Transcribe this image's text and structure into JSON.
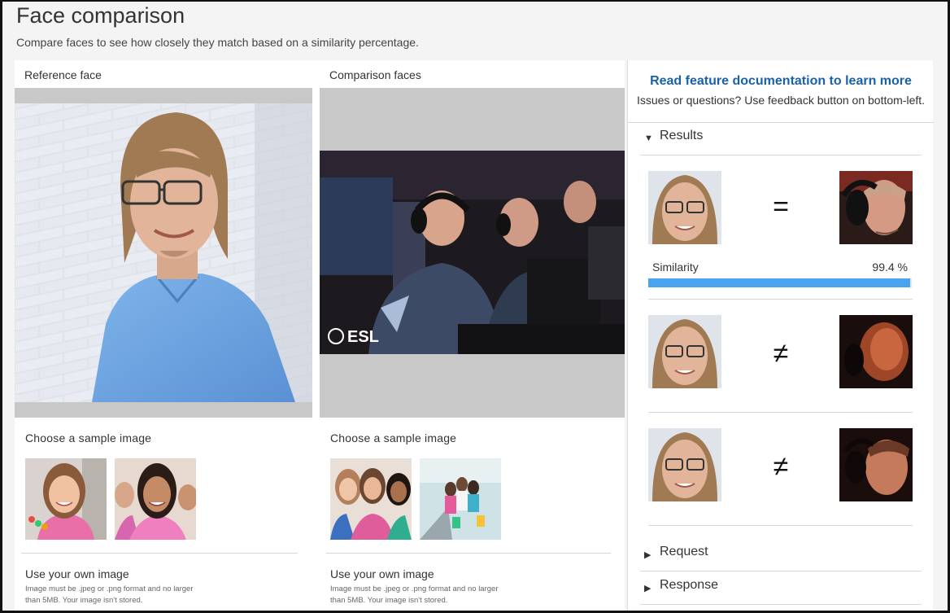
{
  "page": {
    "title": "Face comparison",
    "subtitle": "Compare faces to see how closely they match based on a similarity percentage."
  },
  "reference": {
    "title": "Reference face",
    "sample_title": "Choose a sample image",
    "own_title": "Use your own image",
    "own_desc": "Image must be .jpeg or .png format and no larger than 5MB. Your image isn't stored."
  },
  "comparison": {
    "title": "Comparison faces",
    "sample_title": "Choose a sample image",
    "own_title": "Use your own image",
    "own_desc": "Image must be .jpeg or .png format and no larger than 5MB. Your image isn't stored.",
    "photo_logo_text": "ESL"
  },
  "sidebar": {
    "doc_link": "Read feature documentation to learn more",
    "doc_note": "Issues or questions? Use feedback button on bottom-left.",
    "results_label": "Results",
    "request_label": "Request",
    "response_label": "Response",
    "results": [
      {
        "match_symbol": "=",
        "matched": true
      },
      {
        "match_symbol": "≠",
        "matched": false
      },
      {
        "match_symbol": "≠",
        "matched": false
      }
    ],
    "similarity_label": "Similarity",
    "similarity_value": "99.4 %",
    "similarity_fraction": 0.994
  },
  "colors": {
    "link": "#1a62a8",
    "bar": "#4aa3ee",
    "stage": "#c8c8c8"
  }
}
